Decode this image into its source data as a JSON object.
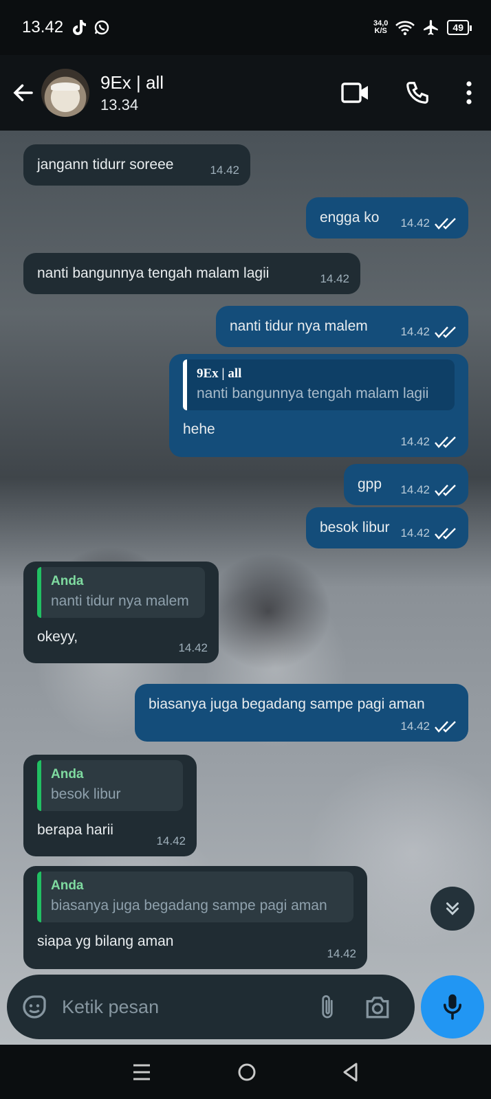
{
  "status_bar": {
    "time": "13.42",
    "speed_value": "34,0",
    "speed_unit": "K/S",
    "battery": "49"
  },
  "header": {
    "contact_name": "9Ex | all",
    "last_seen": "13.34"
  },
  "messages": [
    {
      "direction": "in",
      "text": "jangann tidurr soreee",
      "time": "14.42"
    },
    {
      "direction": "out",
      "text": "engga ko",
      "time": "14.42"
    },
    {
      "direction": "in",
      "text": "nanti bangunnya tengah malam lagii",
      "time": "14.42"
    },
    {
      "direction": "out",
      "text": "nanti tidur nya malem",
      "time": "14.42"
    },
    {
      "direction": "out",
      "text": "hehe",
      "time": "14.42",
      "quote": {
        "name": "9Ex | all",
        "text": "nanti bangunnya tengah malam lagii"
      }
    },
    {
      "direction": "out",
      "text": "gpp",
      "time": "14.42"
    },
    {
      "direction": "out",
      "text": "besok libur",
      "time": "14.42"
    },
    {
      "direction": "in",
      "text": "okeyy,",
      "time": "14.42",
      "quote": {
        "name": "Anda",
        "text": "nanti tidur nya malem"
      }
    },
    {
      "direction": "out",
      "text": "biasanya juga begadang sampe pagi aman",
      "time": "14.42"
    },
    {
      "direction": "in",
      "text": "berapa harii",
      "time": "14.42",
      "quote": {
        "name": "Anda",
        "text": "besok libur"
      }
    },
    {
      "direction": "in",
      "text": "siapa yg bilang aman",
      "time": "14.42",
      "quote": {
        "name": "Anda",
        "text": "biasanya juga begadang sampe pagi aman"
      }
    }
  ],
  "composer": {
    "placeholder": "Ketik pesan"
  },
  "icons": {
    "back": "arrow-left-icon",
    "video_call": "video-camera-icon",
    "voice_call": "phone-icon",
    "menu": "more-vert-icon",
    "sticker": "sticker-icon",
    "attach": "paperclip-icon",
    "camera": "camera-icon",
    "mic": "mic-icon",
    "scroll_down": "double-chevron-down-icon",
    "read_receipt": "double-check-icon"
  },
  "colors": {
    "incoming_bubble": "#202c33",
    "outgoing_bubble": "#144d7a",
    "mic_button": "#2196f3",
    "quote_bar_in": "#21c063"
  }
}
